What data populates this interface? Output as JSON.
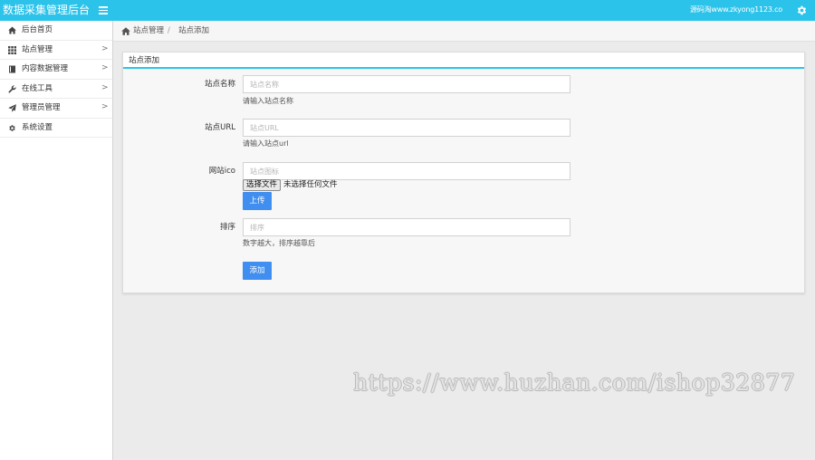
{
  "header": {
    "title": "数据采集管理后台",
    "menu_icon": "hamburger-menu-icon",
    "site_link": "源码淘www.zkyong1123.co",
    "settings_icon": "gear-icon",
    "background_color": "#2cc3ea"
  },
  "sidebar": {
    "items": [
      {
        "label": "后台首页",
        "icon": "home-icon",
        "has_submenu": false
      },
      {
        "label": "站点管理",
        "icon": "grid-icon",
        "has_submenu": true
      },
      {
        "label": "内容数据管理",
        "icon": "book-icon",
        "has_submenu": true
      },
      {
        "label": "在线工具",
        "icon": "wrench-icon",
        "has_submenu": true
      },
      {
        "label": "管理员管理",
        "icon": "send-icon",
        "has_submenu": true
      },
      {
        "label": "系统设置",
        "icon": "cog-icon",
        "has_submenu": false
      }
    ],
    "chevron": ">"
  },
  "breadcrumb": {
    "home_icon": "home-icon",
    "items": [
      "站点管理",
      "站点添加"
    ],
    "separator": "/"
  },
  "panel": {
    "title": "站点添加",
    "accent_color": "#2cc3ea"
  },
  "form": {
    "site_name": {
      "label": "站点名称",
      "placeholder": "站点名称",
      "value": "",
      "help": "请输入站点名称"
    },
    "site_url": {
      "label": "站点URL",
      "placeholder": "站点URL",
      "value": "",
      "help": "请输入站点url"
    },
    "site_ico": {
      "label": "网站ico",
      "placeholder": "站点图标",
      "value": "",
      "file_button": "选择文件",
      "file_status": "未选择任何文件",
      "upload_button": "上传"
    },
    "sort": {
      "label": "排序",
      "placeholder": "排序",
      "value": "",
      "help": "数字越大，排序越靠后"
    },
    "submit_button": "添加",
    "button_color": "#3f8ef0"
  },
  "watermark": "https://www.huzhan.com/ishop32877"
}
